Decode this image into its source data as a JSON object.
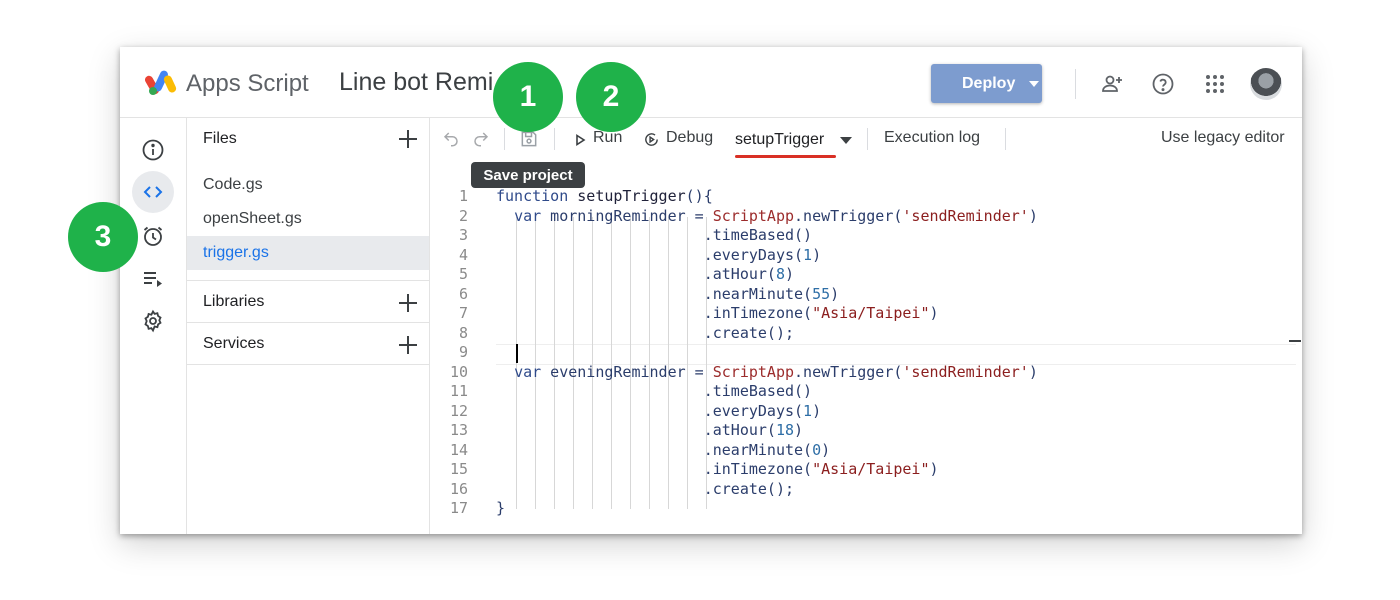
{
  "header": {
    "app_name": "Apps Script",
    "project_title": "Line bot Remi",
    "deploy_label": "Deploy",
    "icons": [
      "add-person-icon",
      "help-icon",
      "apps-grid-icon"
    ]
  },
  "left_rail": {
    "icons": [
      "info-icon",
      "code-icon",
      "alarm-clock-icon",
      "executions-icon",
      "gear-icon"
    ]
  },
  "files_panel": {
    "header": "Files",
    "items": [
      {
        "name": "Code.gs"
      },
      {
        "name": "openSheet.gs"
      },
      {
        "name": "trigger.gs"
      }
    ],
    "selected": "trigger.gs",
    "libraries_label": "Libraries",
    "services_label": "Services"
  },
  "toolbar": {
    "run_label": "Run",
    "debug_label": "Debug",
    "function_selected": "setupTrigger",
    "execution_log_label": "Execution log",
    "legacy_label": "Use legacy editor",
    "tooltip": "Save project"
  },
  "code": {
    "line_numbers": [
      "1",
      "2",
      "3",
      "4",
      "5",
      "6",
      "7",
      "8",
      "9",
      "10",
      "11",
      "12",
      "13",
      "14",
      "15",
      "16",
      "17"
    ]
  },
  "markers": [
    "1",
    "2",
    "3"
  ],
  "colors": {
    "deploy": "#7d9ccf",
    "marker": "#1fb24a",
    "selected_file": "#1a73e8",
    "underline": "#d93025"
  }
}
